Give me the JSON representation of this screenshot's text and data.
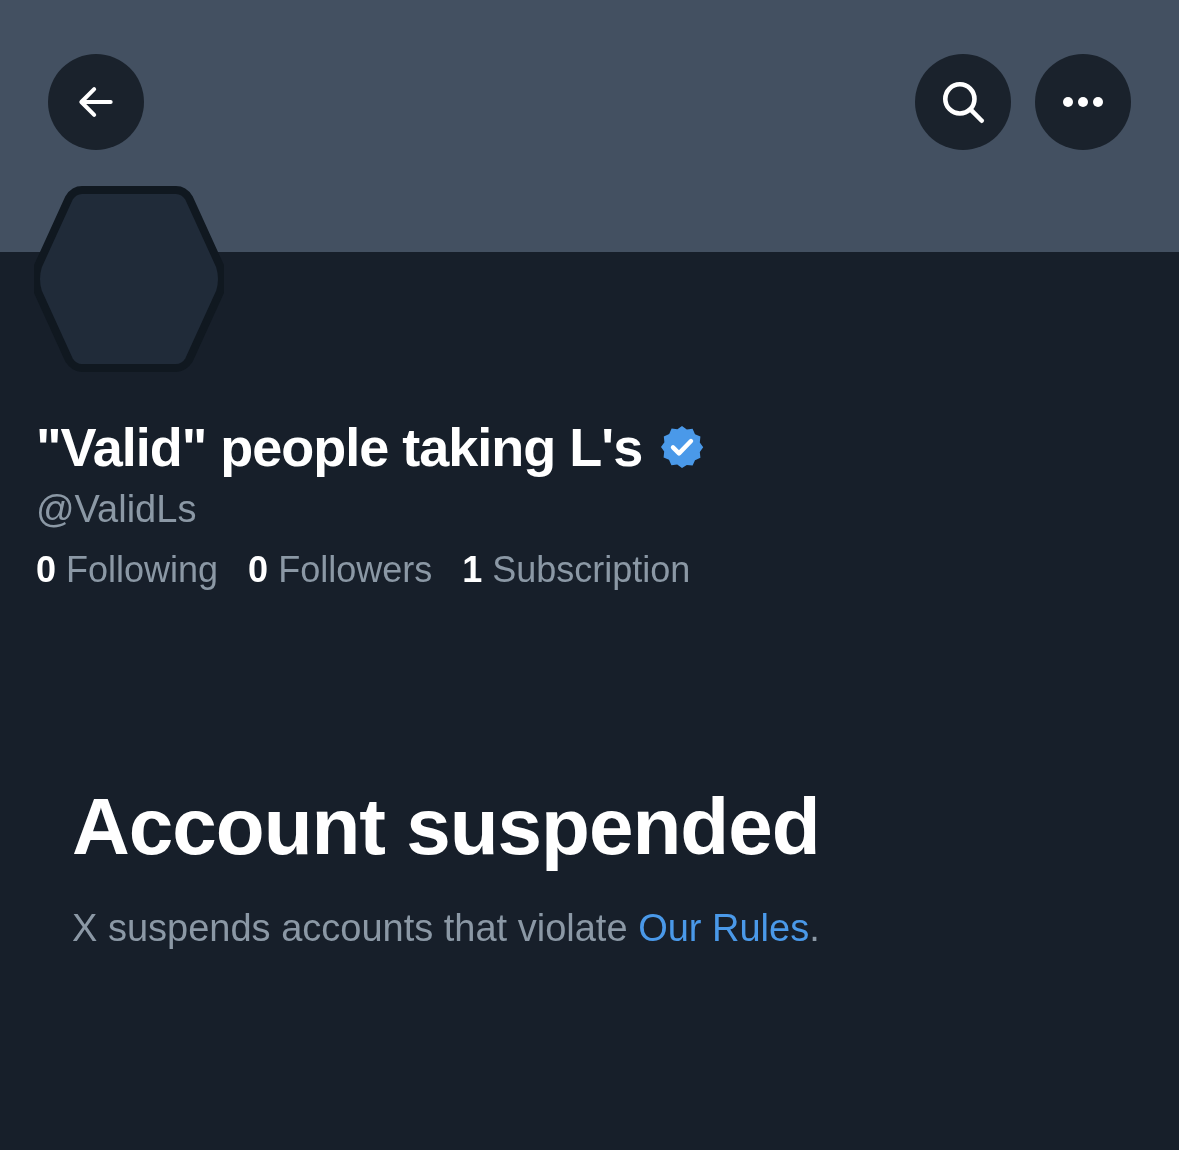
{
  "profile": {
    "name": "\"Valid\" people taking L's",
    "verified": true,
    "handle": "@ValidLs",
    "stats": [
      {
        "count": "0",
        "label": "Following"
      },
      {
        "count": "0",
        "label": "Followers"
      },
      {
        "count": "1",
        "label": "Subscription"
      }
    ]
  },
  "notice": {
    "title": "Account suspended",
    "text": "X suspends accounts that violate ",
    "link": "Our Rules",
    "end": "."
  }
}
